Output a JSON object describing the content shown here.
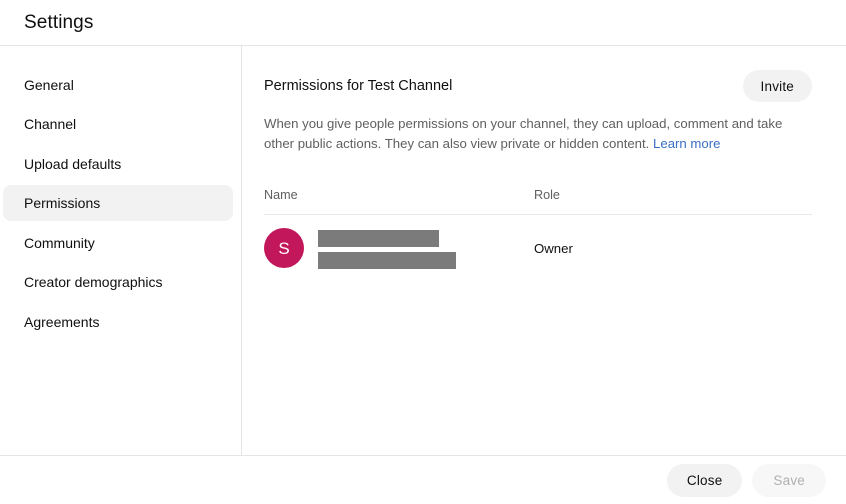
{
  "dialog": {
    "title": "Settings"
  },
  "sidebar": {
    "items": [
      {
        "label": "General",
        "active": false
      },
      {
        "label": "Channel",
        "active": false
      },
      {
        "label": "Upload defaults",
        "active": false
      },
      {
        "label": "Permissions",
        "active": true
      },
      {
        "label": "Community",
        "active": false
      },
      {
        "label": "Creator demographics",
        "active": false
      },
      {
        "label": "Agreements",
        "active": false
      }
    ]
  },
  "main": {
    "section_title": "Permissions for Test Channel",
    "invite_button": "Invite",
    "description_text": "When you give people permissions on your channel, they can upload, comment and take other public actions. They can also view private or hidden content.",
    "learn_more_label": "Learn more",
    "table": {
      "headers": {
        "name": "Name",
        "role": "Role"
      },
      "rows": [
        {
          "avatar_initial": "S",
          "avatar_color": "#c2185b",
          "name_redacted": true,
          "role": "Owner"
        }
      ]
    }
  },
  "footer": {
    "close_label": "Close",
    "save_label": "Save"
  },
  "colors": {
    "accent_link": "#3a6fc4",
    "avatar_bg": "#c2185b",
    "redaction_bar": "#7b7b7b",
    "active_nav_bg": "#f2f2f2",
    "divider": "#e5e5e5"
  }
}
